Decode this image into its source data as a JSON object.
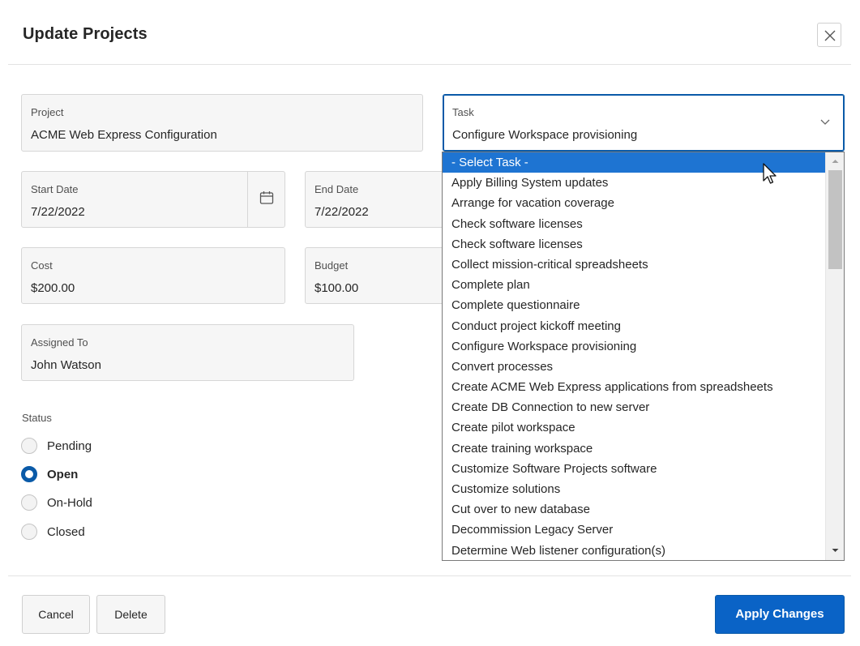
{
  "dialog": {
    "title": "Update Projects",
    "close_icon": "close-icon"
  },
  "fields": {
    "project": {
      "label": "Project",
      "value": "ACME Web Express Configuration"
    },
    "task": {
      "label": "Task",
      "value": "Configure Workspace provisioning"
    },
    "start_date": {
      "label": "Start Date",
      "value": "7/22/2022"
    },
    "end_date": {
      "label": "End Date",
      "value": "7/22/2022"
    },
    "cost": {
      "label": "Cost",
      "value": "$200.00"
    },
    "budget": {
      "label": "Budget",
      "value": "$100.00"
    },
    "assigned_to": {
      "label": "Assigned To",
      "value": "John Watson"
    }
  },
  "status": {
    "label": "Status",
    "options": [
      "Pending",
      "Open",
      "On-Hold",
      "Closed"
    ],
    "selected": "Open"
  },
  "task_dropdown": {
    "highlighted": "- Select Task -",
    "options": [
      "- Select Task -",
      "Apply Billing System updates",
      "Arrange for vacation coverage",
      "Check software licenses",
      "Check software licenses",
      "Collect mission-critical spreadsheets",
      "Complete plan",
      "Complete questionnaire",
      "Conduct project kickoff meeting",
      "Configure Workspace provisioning",
      "Convert processes",
      "Create ACME Web Express applications from spreadsheets",
      "Create DB Connection to new server",
      "Create pilot workspace",
      "Create training workspace",
      "Customize Software Projects software",
      "Customize solutions",
      "Cut over to new database",
      "Decommission Legacy Server",
      "Determine Web listener configuration(s)"
    ]
  },
  "footer": {
    "cancel_label": "Cancel",
    "delete_label": "Delete",
    "apply_label": "Apply Changes"
  },
  "colors": {
    "accent": "#0a63c6",
    "selection": "#1e74d2"
  },
  "icons": {
    "calendar": "calendar-icon",
    "chevron": "chevron-down-icon"
  }
}
